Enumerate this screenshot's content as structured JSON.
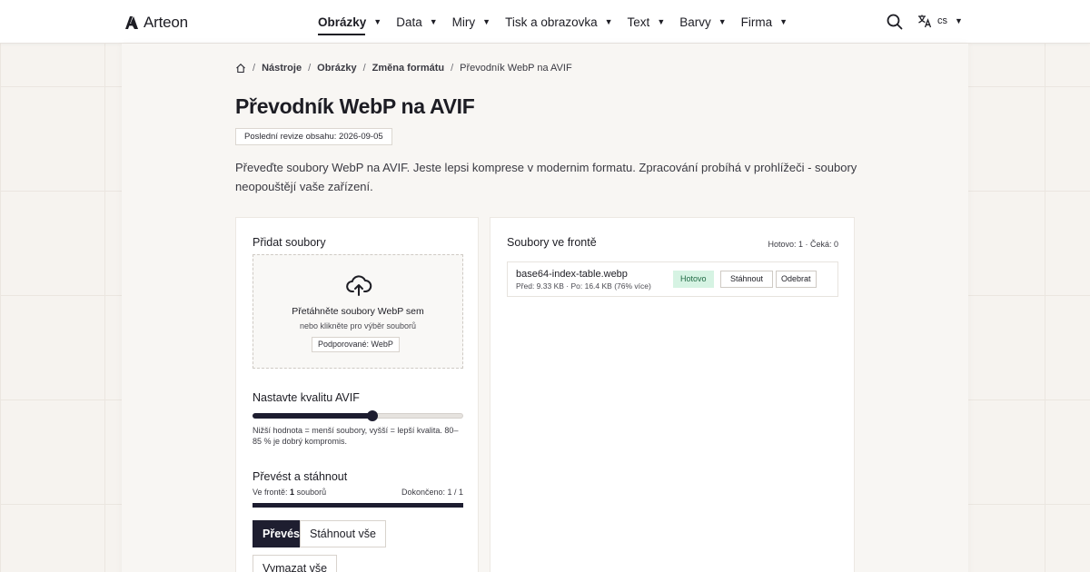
{
  "brand": {
    "name": "Arteon"
  },
  "nav": {
    "items": [
      {
        "label": "Obrázky",
        "active": true
      },
      {
        "label": "Data"
      },
      {
        "label": "Miry"
      },
      {
        "label": "Tisk a obrazovka"
      },
      {
        "label": "Text"
      },
      {
        "label": "Barvy"
      },
      {
        "label": "Firma"
      }
    ],
    "search_icon": "search-icon",
    "language": {
      "code": "cs",
      "icon": "translate-icon"
    }
  },
  "breadcrumb": {
    "home_icon": "home-icon",
    "items": [
      "Nástroje",
      "Obrázky",
      "Změna formátu"
    ],
    "current": "Převodník WebP na AVIF"
  },
  "page": {
    "title": "Převodník WebP na AVIF",
    "revision": "Poslední revize obsahu: 2026-09-05",
    "intro": "Převeďte soubory WebP na AVIF. Jeste lepsi komprese v modernim formatu. Zpracování probíhá v prohlížeči - soubory neopouštějí vaše zařízení."
  },
  "upload": {
    "heading": "Přidat soubory",
    "icon": "cloud-upload-icon",
    "dropzone_title": "Přetáhněte soubory WebP sem",
    "dropzone_sub": "nebo klikněte pro výběr souborů",
    "supported": "Podporované: WebP"
  },
  "quality": {
    "heading": "Nastavte kvalitu AVIF",
    "value_fraction": 0.57,
    "hint": "Nižší hodnota = menší soubory, vyšší = lepší kvalita. 80–85 % je dobrý kompromis."
  },
  "convert": {
    "heading": "Převést a stáhnout",
    "queue_prefix": "Ve frontě:",
    "queue_count": "1",
    "queue_suffix": "souborů",
    "completed": "Dokončeno: 1 / 1",
    "progress_fraction": 1.0,
    "convert_label": "Převést",
    "download_all_label": "Stáhnout vše",
    "clear_all_label": "Vymazat vše"
  },
  "queue": {
    "heading": "Soubory ve frontě",
    "status": "Hotovo: 1 · Čeká: 0",
    "files": [
      {
        "name": "base64-index-table.webp",
        "meta": "Před: 9.33 KB · Po: 16.4 KB (76% více)",
        "status": "Hotovo",
        "download_label": "Stáhnout",
        "remove_label": "Odebrat"
      }
    ]
  },
  "colors": {
    "accent": "#1e1e30",
    "success_bg": "#d6f3e3",
    "success_text": "#1f6a43",
    "page_bg": "#f6f3ef"
  }
}
